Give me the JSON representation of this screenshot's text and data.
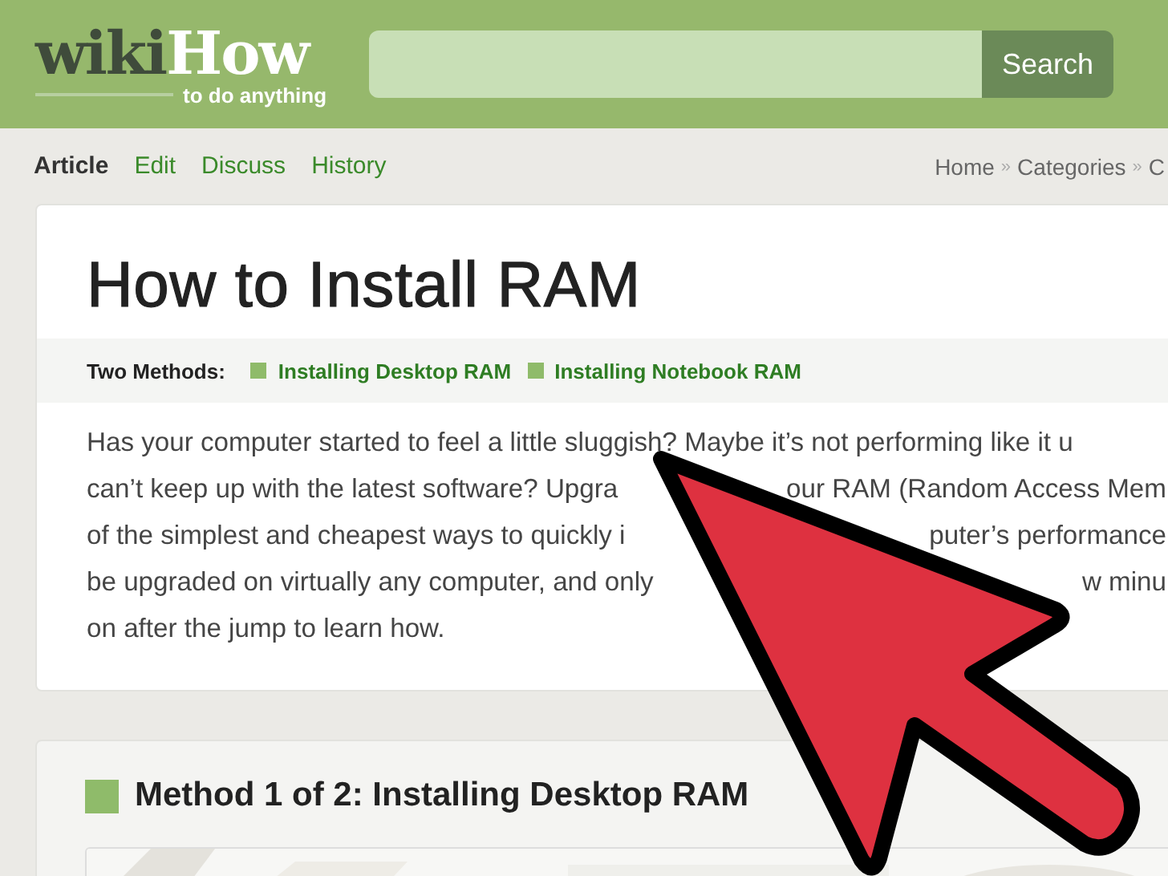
{
  "header": {
    "logo": {
      "part_1": "wiki",
      "part_2": "How",
      "tagline": "to do anything"
    },
    "search": {
      "button": "Search"
    }
  },
  "tabs": [
    {
      "label": "Article",
      "selected": true
    },
    {
      "label": "Edit",
      "selected": false
    },
    {
      "label": "Discuss",
      "selected": false
    },
    {
      "label": "History",
      "selected": false
    }
  ],
  "breadcrumb": {
    "separator": "»",
    "items": [
      "Home",
      "Categories",
      "C"
    ]
  },
  "article": {
    "title": "How to Install RAM",
    "methods_label": "Two Methods:",
    "methods": [
      "Installing Desktop RAM",
      "Installing Notebook RAM"
    ],
    "intro_lines": [
      [
        "Has your computer started to feel a little sluggish? Maybe it’s not performing like it u"
      ],
      [
        "can’t keep up with the latest software? Upgra",
        "our RAM (Random Access Mem"
      ],
      [
        "of the simplest and cheapest ways to quickly i",
        "puter’s performance"
      ],
      [
        "be upgraded on virtually any computer, and only",
        "w minu"
      ],
      [
        "on after the jump to learn how."
      ]
    ]
  },
  "method_section": {
    "heading": "Method 1 of 2: Installing Desktop RAM"
  }
}
